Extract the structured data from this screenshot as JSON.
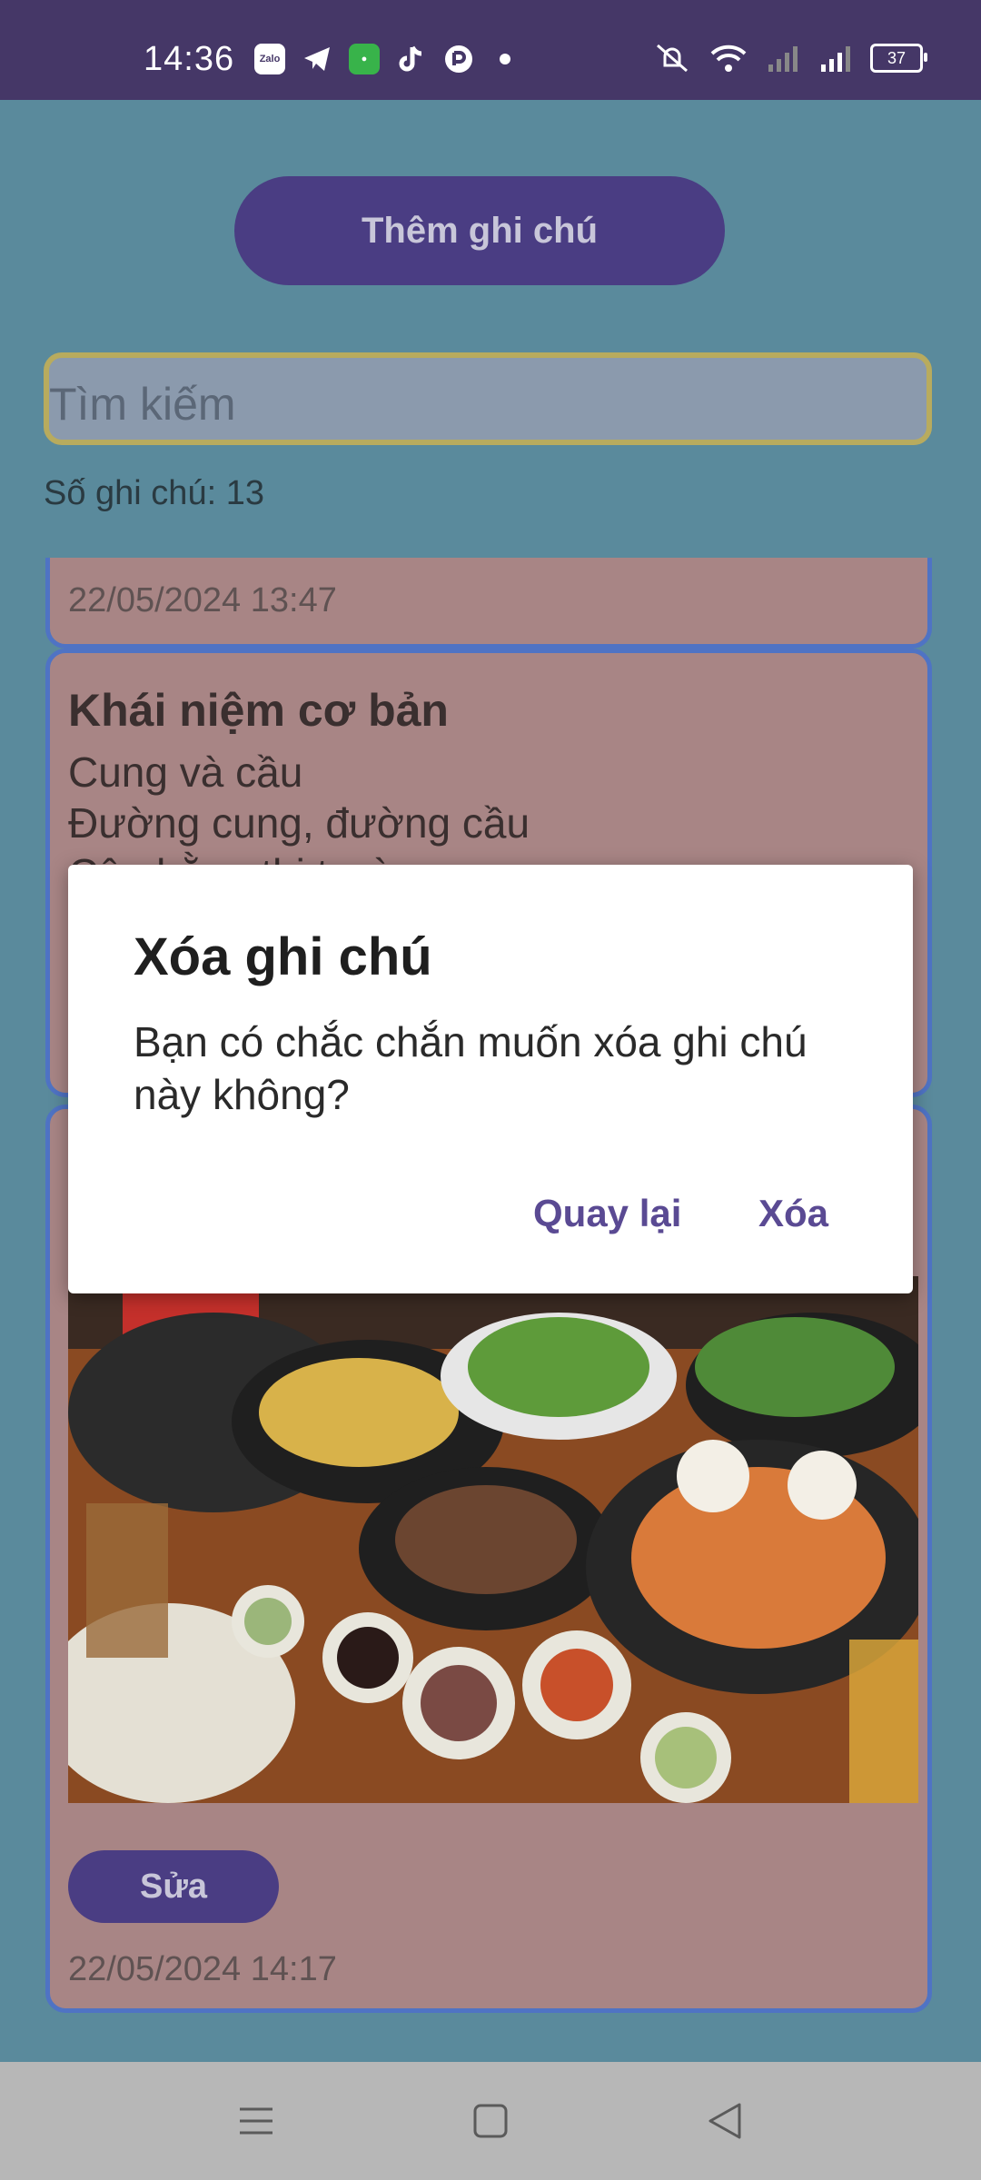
{
  "status_bar": {
    "time": "14:36",
    "apps": [
      "Zalo",
      "Telegram",
      "Store",
      "TikTok",
      "Messenger"
    ],
    "battery": "37"
  },
  "main": {
    "add_button_label": "Thêm ghi chú",
    "search_placeholder": "Tìm kiếm",
    "note_count": "Số ghi chú: 13",
    "notes": [
      {
        "date": "22/05/2024 13:47"
      },
      {
        "title": "Khái niệm cơ bản",
        "lines": [
          "Cung và cầu",
          "Đường cung, đường cầu",
          "Cân bằng thị trường"
        ]
      },
      {
        "edit_label": "Sửa",
        "date": "22/05/2024 14:17"
      }
    ]
  },
  "dialog": {
    "title": "Xóa ghi chú",
    "message": "Bạn có chắc chắn muốn xóa ghi chú này không?",
    "cancel_label": "Quay lại",
    "confirm_label": "Xóa"
  },
  "nav": {
    "icons": [
      "menu-icon",
      "home-icon",
      "back-icon"
    ]
  },
  "colors": {
    "status_bar": "#453767",
    "background": "#5a8a9c",
    "accent": "#4a3d83",
    "card": "#a88585",
    "card_border": "#4f73c4"
  }
}
